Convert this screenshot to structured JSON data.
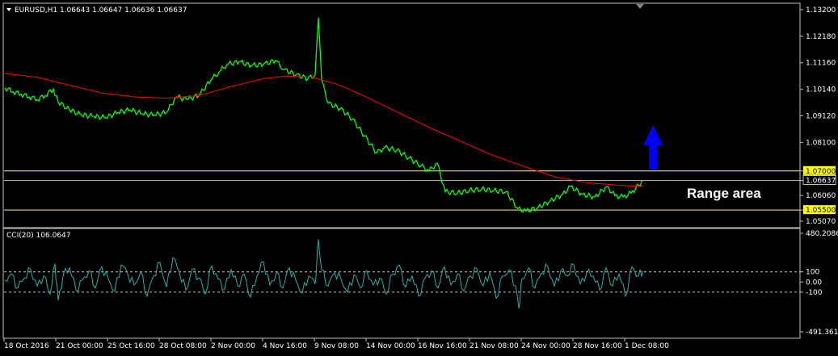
{
  "header": {
    "title": "EURUSD,H1  1.06643 1.06647 1.06636 1.06637"
  },
  "indicator": {
    "title": "CCI(20) 106.0647"
  },
  "annotation": {
    "range_label": "Range area"
  },
  "colors": {
    "background": "#000000",
    "price": "#00ff00",
    "moving_average": "#ff0000",
    "levels": "#ffff66",
    "cci": "#20b2aa",
    "arrow": "#0000ff",
    "axis_text": "#ffffff"
  },
  "chart_data": [
    {
      "type": "line",
      "title": "EURUSD,H1  1.06643 1.06647 1.06636 1.06637",
      "x": [
        "18 Oct 2016",
        "21 Oct 00:00",
        "25 Oct 16:00",
        "28 Oct 08:00",
        "2 Nov 00:00",
        "4 Nov 16:00",
        "9 Nov 08:00",
        "14 Nov 00:00",
        "16 Nov 16:00",
        "21 Nov 08:00",
        "24 Nov 00:00",
        "28 Nov 16:00",
        "1 Dec 08:00"
      ],
      "ylim": [
        1.0507,
        1.132
      ],
      "y_ticks": [
        "1.13200",
        "1.12180",
        "1.11160",
        "1.10140",
        "1.09120",
        "1.08100",
        "1.07000",
        "1.06637",
        "1.06060",
        "1.05500",
        "1.05070"
      ],
      "series": [
        {
          "name": "EURUSD",
          "color": "#00ff00",
          "x": [
            0,
            10,
            20,
            30,
            40,
            50,
            60,
            66,
            80,
            95,
            110,
            125,
            140,
            155,
            170,
            185,
            200,
            212,
            225,
            240,
            255,
            265,
            275,
            290,
            305,
            320,
            335,
            345,
            360,
            375,
            384,
            388,
            392,
            400,
            415,
            430,
            445,
            460,
            470,
            485,
            500,
            515,
            525,
            535,
            545,
            560,
            575,
            590,
            605,
            620,
            635,
            645,
            660,
            675,
            690,
            700,
            715,
            730,
            745,
            755,
            765,
            775,
            790
          ],
          "y": [
            1.102,
            1.1005,
            1.0995,
            1.0985,
            1.0975,
            1.099,
            1.1015,
            1.0965,
            1.0935,
            1.0915,
            1.091,
            1.0905,
            1.0925,
            1.0935,
            1.092,
            1.0915,
            1.0925,
            1.0985,
            1.0975,
            1.099,
            1.105,
            1.108,
            1.111,
            1.112,
            1.1105,
            1.111,
            1.1125,
            1.109,
            1.107,
            1.1055,
            1.107,
            1.129,
            1.105,
            1.096,
            1.094,
            1.09,
            1.0835,
            1.077,
            1.079,
            1.078,
            1.075,
            1.072,
            1.07,
            1.073,
            1.062,
            1.0615,
            1.0625,
            1.063,
            1.0625,
            1.062,
            1.0555,
            1.0545,
            1.056,
            1.0585,
            1.061,
            1.064,
            1.061,
            1.06,
            1.064,
            1.0605,
            1.06,
            1.0615,
            1.0664
          ]
        },
        {
          "name": "Moving Average",
          "color": "#ff0000",
          "x": [
            0,
            40,
            80,
            120,
            160,
            200,
            240,
            280,
            320,
            350,
            380,
            410,
            440,
            470,
            500,
            530,
            560,
            600,
            640,
            680,
            720,
            760,
            790
          ],
          "y": [
            1.1075,
            1.106,
            1.103,
            1.1,
            1.0985,
            1.098,
            1.099,
            1.1025,
            1.1055,
            1.1065,
            1.106,
            1.1035,
            1.0995,
            1.095,
            1.0905,
            1.086,
            1.082,
            1.0765,
            1.072,
            1.0678,
            1.0655,
            1.0645,
            1.064
          ]
        }
      ],
      "levels": [
        {
          "value": 1.07,
          "label": "1.07000",
          "color": "#ffff66"
        },
        {
          "value": 1.055,
          "label": "1.05500",
          "color": "#ffff66"
        },
        {
          "value": 1.06637,
          "label": "1.06637",
          "color": "#aaaaaa"
        }
      ]
    },
    {
      "type": "line",
      "title": "CCI(20) 106.0647",
      "ylim": [
        -491.3611,
        480.2086
      ],
      "y_ticks": [
        "480.2086",
        "100",
        "0.00",
        "-100",
        "-491.3611"
      ],
      "reference_lines": [
        100,
        -100
      ],
      "series": [
        {
          "name": "CCI(20)",
          "color": "#20b2aa",
          "x": [
            0,
            8,
            16,
            24,
            32,
            40,
            48,
            56,
            62,
            66,
            72,
            80,
            88,
            96,
            104,
            112,
            120,
            128,
            136,
            144,
            152,
            160,
            168,
            176,
            184,
            192,
            200,
            208,
            216,
            224,
            232,
            240,
            248,
            256,
            264,
            272,
            280,
            288,
            296,
            304,
            312,
            320,
            328,
            336,
            344,
            352,
            360,
            368,
            376,
            384,
            388,
            392,
            400,
            408,
            416,
            424,
            432,
            440,
            448,
            456,
            464,
            472,
            480,
            488,
            496,
            504,
            512,
            520,
            528,
            536,
            544,
            552,
            560,
            568,
            576,
            584,
            592,
            600,
            608,
            616,
            624,
            632,
            636,
            640,
            648,
            656,
            664,
            672,
            680,
            688,
            696,
            704,
            712,
            720,
            728,
            736,
            744,
            752,
            760,
            768,
            776,
            784,
            790
          ],
          "y": [
            20,
            80,
            -60,
            40,
            120,
            -40,
            60,
            -120,
            180,
            -180,
            60,
            140,
            -80,
            20,
            110,
            -60,
            150,
            30,
            -90,
            170,
            80,
            -30,
            100,
            -140,
            60,
            190,
            -50,
            240,
            90,
            -80,
            130,
            40,
            -120,
            160,
            30,
            -70,
            120,
            -40,
            80,
            -150,
            60,
            200,
            -30,
            90,
            -60,
            140,
            20,
            -110,
            60,
            -20,
            420,
            120,
            -40,
            90,
            30,
            -100,
            70,
            -60,
            110,
            -30,
            40,
            -120,
            80,
            170,
            -50,
            60,
            -140,
            40,
            110,
            -60,
            150,
            -30,
            80,
            -90,
            60,
            130,
            -40,
            90,
            -160,
            60,
            120,
            -40,
            -260,
            30,
            140,
            -60,
            90,
            150,
            -40,
            110,
            60,
            170,
            -20,
            90,
            60,
            -80,
            140,
            -40,
            80,
            -140,
            150,
            60,
            106.06
          ]
        }
      ]
    }
  ]
}
